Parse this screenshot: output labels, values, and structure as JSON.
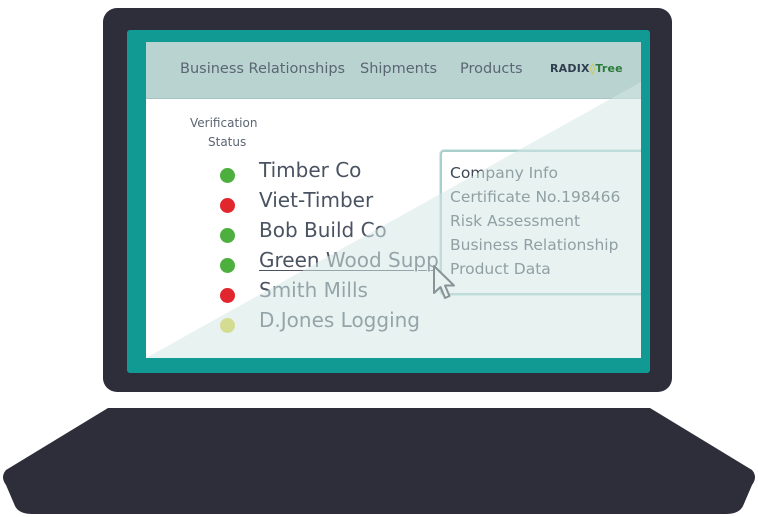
{
  "nav": {
    "items": [
      "Business Relationships",
      "Shipments",
      "Products"
    ],
    "logo_text_a": "RADIX",
    "logo_text_b": "Tree",
    "logo_pin": "◊"
  },
  "verification": {
    "line1": "Verification",
    "line2": "Status"
  },
  "suppliers": [
    {
      "name": "Timber Co",
      "status": "verified",
      "color": "#4caf3e"
    },
    {
      "name": "Viet-Timber",
      "status": "failed",
      "color": "#e1262d"
    },
    {
      "name": "Bob Build Co",
      "status": "verified",
      "color": "#4caf3e"
    },
    {
      "name": "Green Wood Supp",
      "status": "verified",
      "color": "#4caf3e",
      "hovered": true
    },
    {
      "name": "Smith Mills",
      "status": "failed",
      "color": "#e1262d"
    },
    {
      "name": "D.Jones Logging",
      "status": "pending",
      "color": "#d6cf2a"
    }
  ],
  "popup": {
    "items": [
      "Company Info",
      "Certificate No.198466",
      "Risk Assessment",
      "Business Relationship",
      "Product Data"
    ]
  },
  "colors": {
    "laptop_body": "#2e2d3a",
    "bezel": "#119a93",
    "header": "#b9d3d1"
  }
}
